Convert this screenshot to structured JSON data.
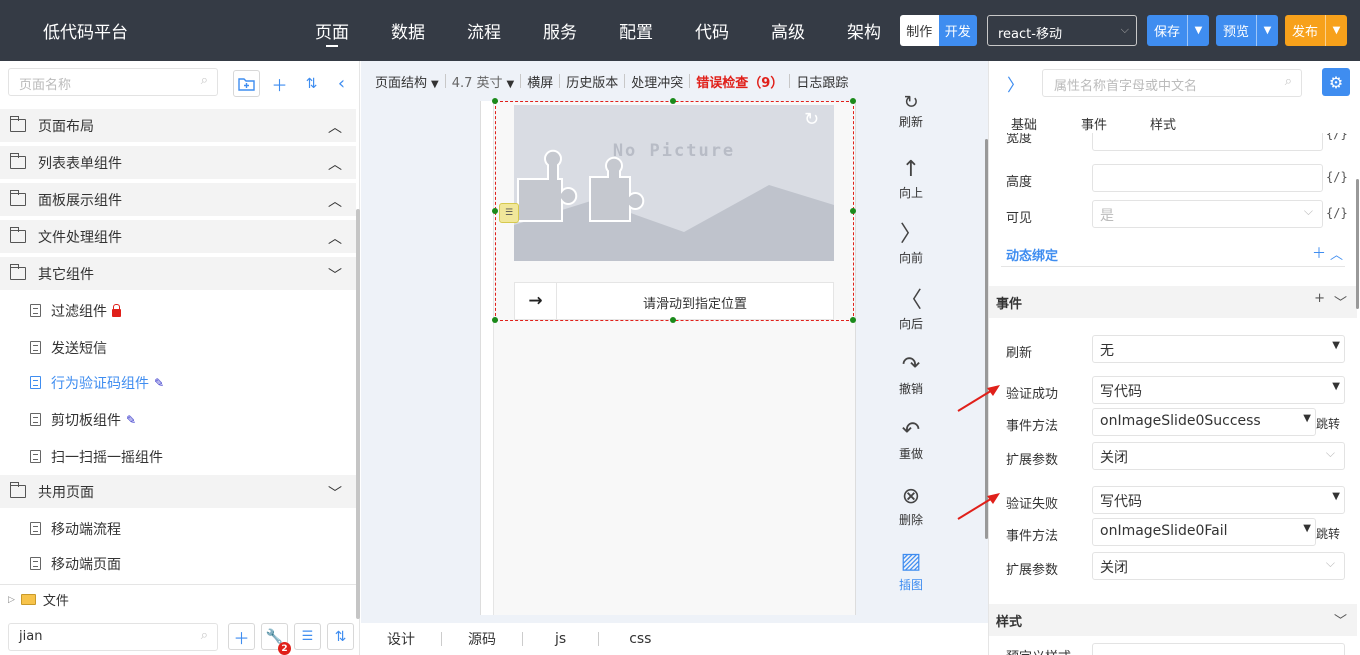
{
  "header": {
    "brand": "低代码平台",
    "nav": [
      "页面",
      "数据",
      "流程",
      "服务",
      "配置",
      "代码",
      "高级",
      "架构"
    ],
    "mode_make": "制作",
    "mode_dev": "开发",
    "tech_select": "react-移动",
    "save_label": "保存",
    "preview_label": "预览",
    "publish_label": "发布"
  },
  "left": {
    "search_placeholder": "页面名称",
    "categories": {
      "layout": "页面布局",
      "list_form": "列表表单组件",
      "panel": "面板展示组件",
      "file": "文件处理组件",
      "other": "其它组件",
      "shared": "共用页面"
    },
    "items": {
      "filter": "过滤组件",
      "sms": "发送短信",
      "captcha": "行为验证码组件",
      "clipboard": "剪切板组件",
      "scan": "扫一扫摇一摇组件",
      "mobile_flow": "移动端流程",
      "mobile_page": "移动端页面"
    },
    "file_label": "文件",
    "bottom_search_value": "jian",
    "badge_count": "2"
  },
  "toolbar": {
    "page_structure": "页面结构",
    "screen_size": "4.7 英寸",
    "landscape": "横屏",
    "history": "历史版本",
    "conflict": "处理冲突",
    "error_check": "错误检查（9）",
    "log_trace": "日志跟踪"
  },
  "canvas": {
    "no_picture": "No Picture",
    "slider_text": "请滑动到指定位置",
    "actions": {
      "refresh": "刷新",
      "up": "向上",
      "forward": "向前",
      "back": "向后",
      "undo": "撤销",
      "redo": "重做",
      "delete": "删除",
      "insert_image": "插图"
    }
  },
  "bottom_tabs": [
    "设计",
    "源码",
    "js",
    "css"
  ],
  "props": {
    "search_placeholder": "属性名称首字母或中文名",
    "tabs": [
      "基础",
      "事件",
      "样式"
    ],
    "width_label": "宽度",
    "height_label": "高度",
    "visible_label": "可见",
    "visible_value": "是",
    "code_tag": "{/}",
    "dynamic_binding": "动态绑定",
    "events_section": "事件",
    "refresh_label": "刷新",
    "refresh_value": "无",
    "success_label": "验证成功",
    "success_value": "写代码",
    "method_label": "事件方法",
    "success_method": "onImageSlide0Success",
    "jump_label": "跳转",
    "ext_label": "扩展参数",
    "ext_value": "关闭",
    "fail_label": "验证失败",
    "fail_value": "写代码",
    "fail_method": "onImageSlide0Fail",
    "style_section": "样式",
    "predefined_style": "预定义样式"
  },
  "colors": {
    "topbar": "#353b45",
    "accent": "#3f8df0",
    "publish": "#f7a11b",
    "error": "#e0201a",
    "selection": "#1a8a1a"
  }
}
